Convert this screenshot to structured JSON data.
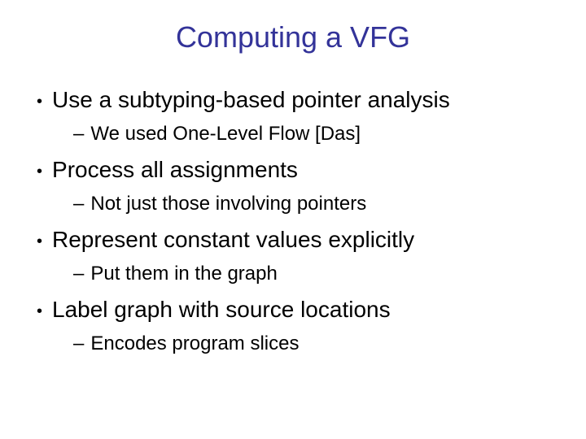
{
  "slide": {
    "title": "Computing a VFG",
    "items": [
      {
        "text": "Use a subtyping-based pointer analysis",
        "sub": "We used One-Level Flow [Das]"
      },
      {
        "text": "Process all assignments",
        "sub": "Not just those involving pointers"
      },
      {
        "text": "Represent constant values explicitly",
        "sub": "Put them in the graph"
      },
      {
        "text": "Label graph with source locations",
        "sub": "Encodes program slices"
      }
    ]
  }
}
